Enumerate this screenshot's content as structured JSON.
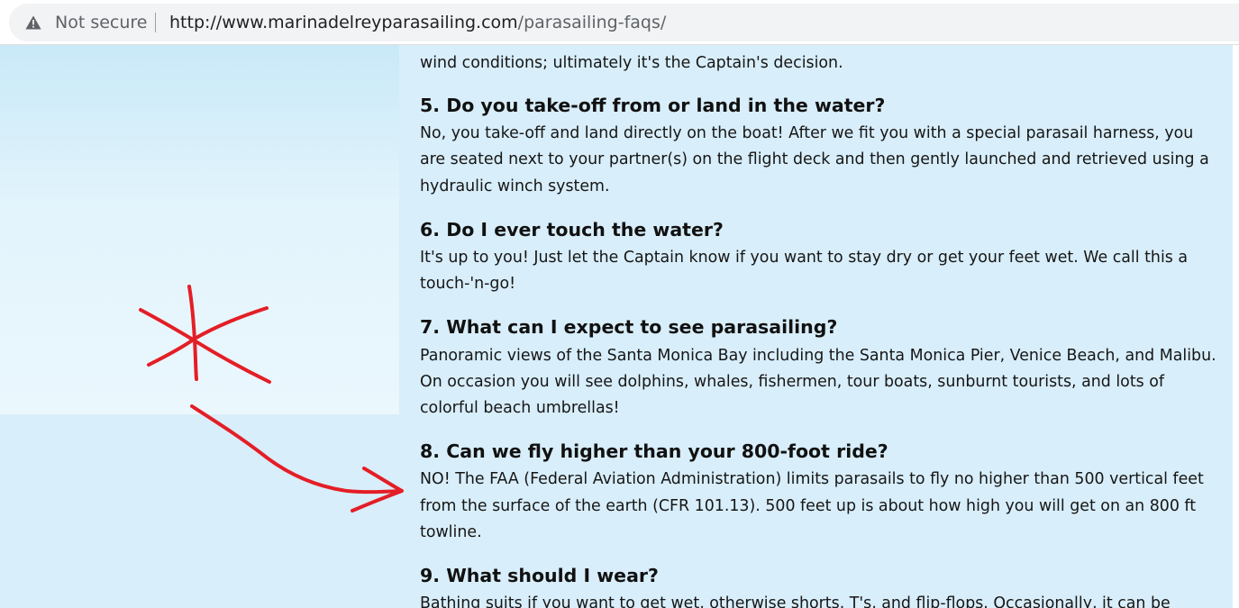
{
  "browser": {
    "security_label": "Not secure",
    "url_host": "http://www.marinadelreyparasailing.com",
    "url_path": "/parasailing-faqs/"
  },
  "faq": {
    "intro_tail": "wind conditions; ultimately it's the Captain's decision.",
    "items": [
      {
        "question": "5. Do you take-off from or land in the water?",
        "answer": [
          "No, you take-off and land directly on the boat! After we fit you with a special parasail harness, you",
          "are seated next to your partner(s) on the flight deck and then gently launched and retrieved using a",
          "hydraulic winch system."
        ]
      },
      {
        "question": "6. Do I ever touch the water?",
        "answer": [
          "It's up to you! Just let the Captain know if you want to stay dry or get your feet wet. We call this a",
          "touch-'n-go!"
        ]
      },
      {
        "question": "7. What can I expect to see parasailing?",
        "answer": [
          "Panoramic views of the Santa Monica Bay including the Santa Monica Pier, Venice Beach, and Malibu.",
          "On occasion you will see dolphins, whales, fishermen, tour boats, sunburnt tourists, and lots of",
          "colorful beach umbrellas!"
        ]
      },
      {
        "question": "8. Can we fly higher than your 800-foot ride?",
        "answer": [
          "NO! The FAA (Federal Aviation Administration) limits parasails to fly no higher than 500 vertical feet",
          "from the surface of the earth (CFR 101.13). 500 feet up is about how high you will get on an 800 ft",
          "towline."
        ]
      },
      {
        "question": "9. What should I wear?",
        "answer": [
          "Bathing suits if you want to get wet, otherwise shorts, T's, and flip-flops. Occasionally, it can be"
        ]
      }
    ]
  },
  "colors": {
    "page_background": "#d8eefa",
    "annotation_red": "#e41e26",
    "heading_text": "#111111"
  },
  "icons": {
    "security": "warning-triangle-icon",
    "annotation_mark": "asterisk-mark",
    "annotation_arrow": "curved-arrow"
  }
}
